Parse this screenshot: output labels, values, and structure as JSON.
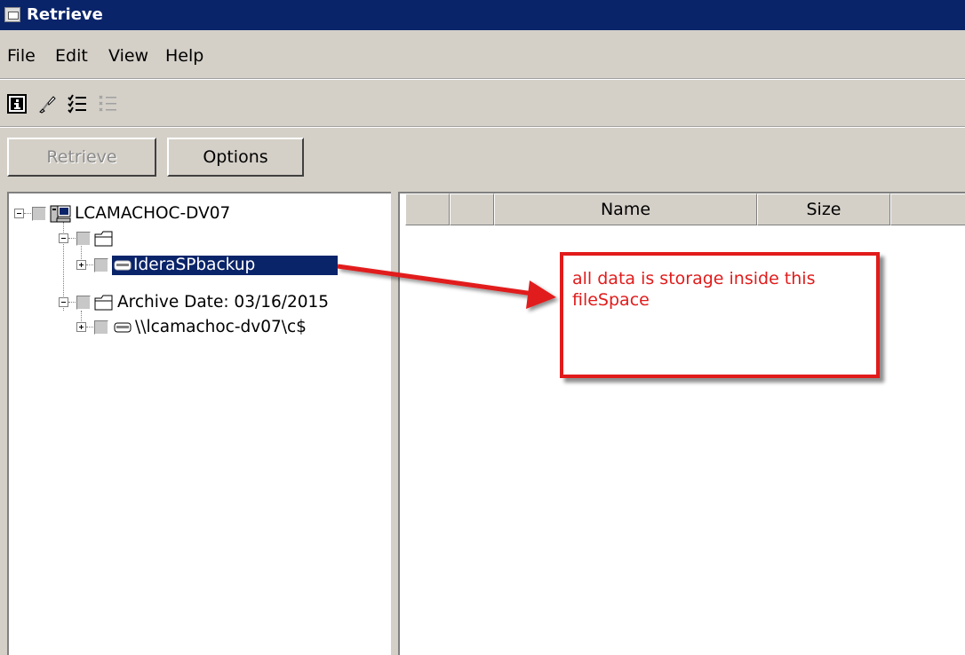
{
  "window": {
    "title": "Retrieve"
  },
  "menu": [
    "File",
    "Edit",
    "View",
    "Help"
  ],
  "toolbar": {
    "icons": [
      "info-icon",
      "brush-icon",
      "checklist-icon",
      "list-icon"
    ]
  },
  "buttons": {
    "retrieve": "Retrieve",
    "options": "Options"
  },
  "tree": {
    "root": "LCAMACHOC-DV07",
    "group1": "",
    "node1": "IderaSPbackup",
    "group2": "Archive Date: 03/16/2015",
    "node2": "\\\\lcamachoc-dv07\\c$"
  },
  "list": {
    "columns": [
      "",
      "",
      "Name",
      "Size",
      ""
    ]
  },
  "callout": {
    "text": "all data is storage inside this fileSpace"
  },
  "colors": {
    "titlebar": "#0a246a",
    "selection": "#0a246a",
    "callout": "#e11b1b"
  }
}
